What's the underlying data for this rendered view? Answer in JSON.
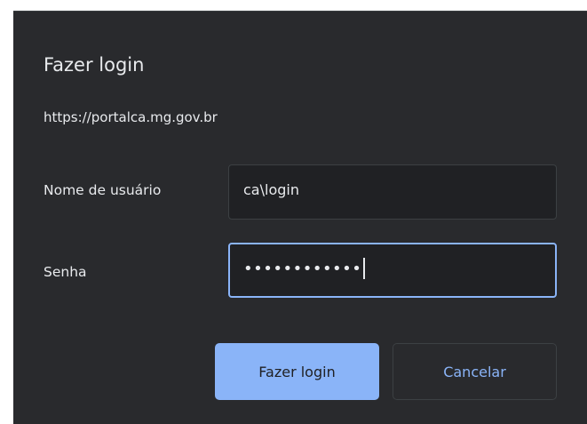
{
  "dialog": {
    "title": "Fazer login",
    "origin": "https://portalca.mg.gov.br"
  },
  "form": {
    "username_label": "Nome de usuário",
    "username_value": "ca\\login",
    "password_label": "Senha",
    "password_masked": "••••••••••••"
  },
  "buttons": {
    "submit_label": "Fazer login",
    "cancel_label": "Cancelar"
  },
  "colors": {
    "background": "#292a2d",
    "field_background": "#202124",
    "accent": "#8ab4f8",
    "text": "#e8eaed"
  }
}
